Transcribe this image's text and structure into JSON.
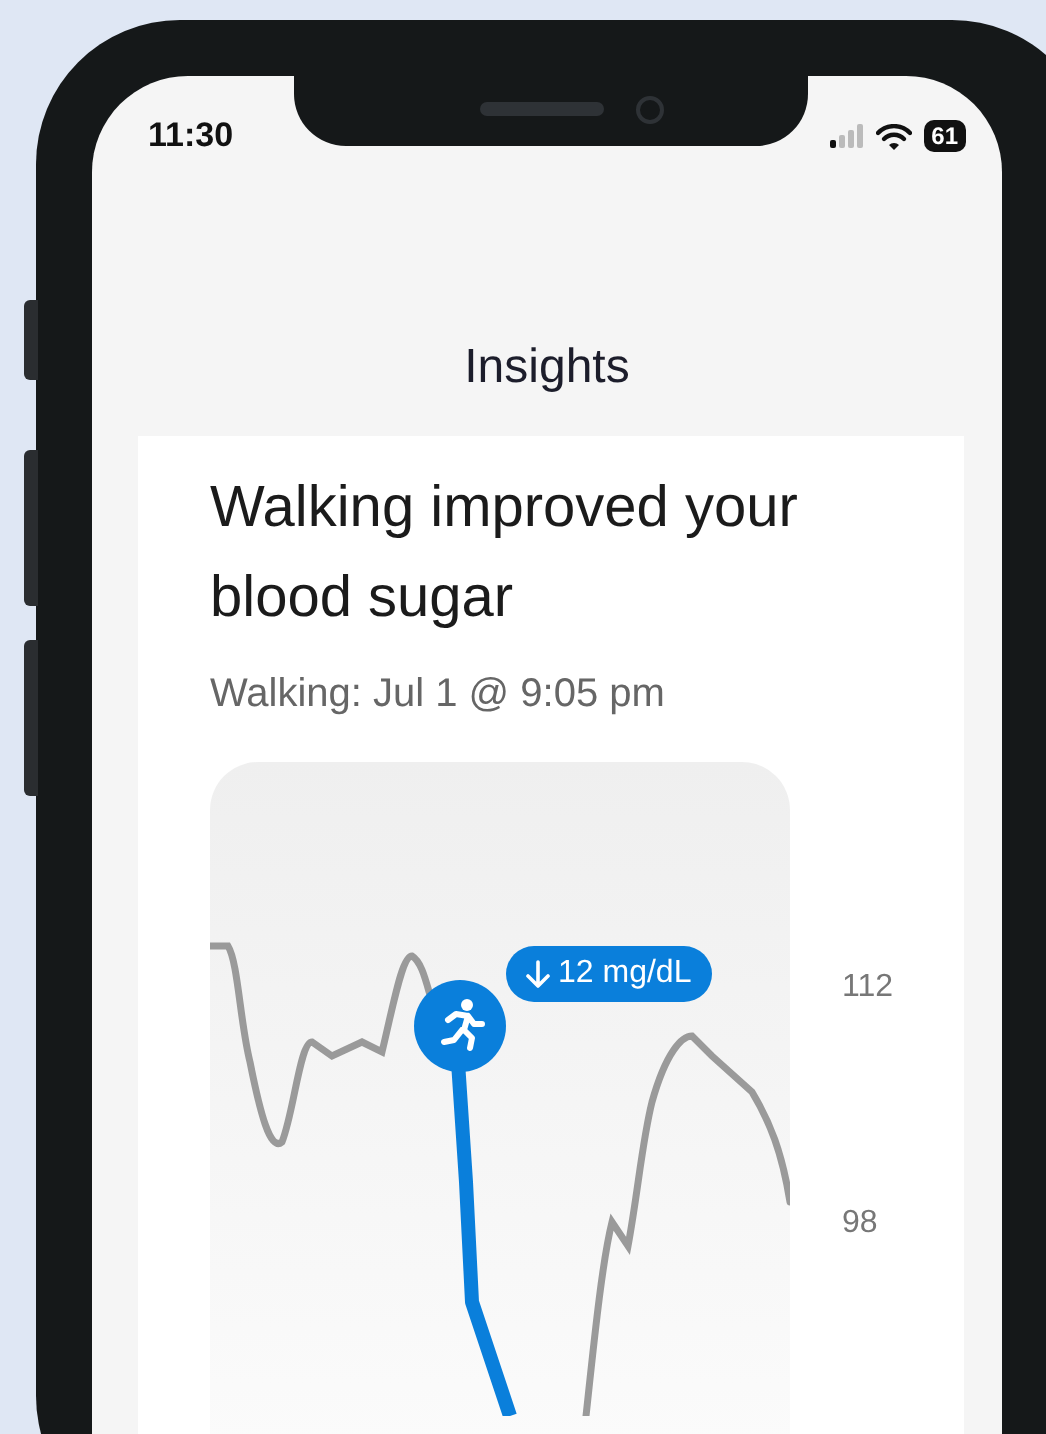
{
  "status_bar": {
    "time": "11:30",
    "battery": "61"
  },
  "title": "Insights",
  "insight": {
    "heading": "Walking improved your blood sugar",
    "subtitle": "Walking: Jul 1 @ 9:05 pm",
    "badge": "12 mg/dL",
    "axis_labels": [
      "112",
      "98"
    ]
  }
}
